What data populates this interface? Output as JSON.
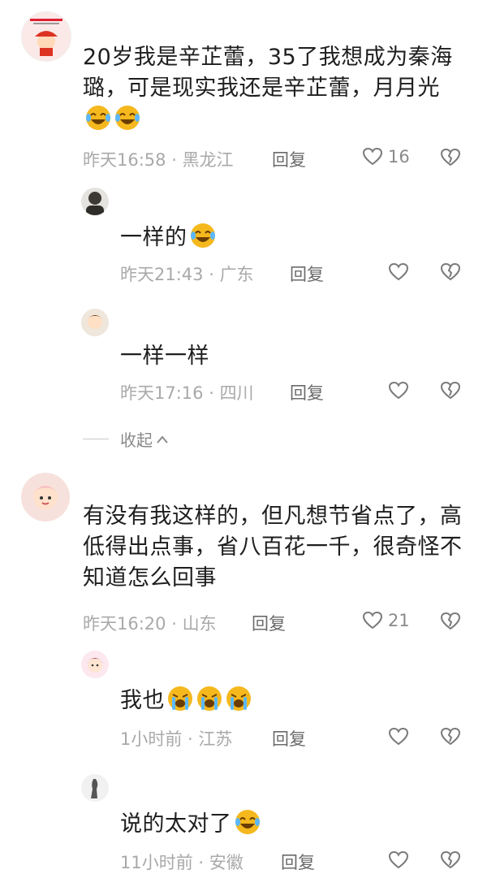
{
  "comments": [
    {
      "text": "20岁我是辛芷蕾，35了我想成为秦海璐，可是现实我还是辛芷蕾，月月光",
      "emoji": [
        "laugh-cry",
        "laugh-cry"
      ],
      "time": "昨天16:58",
      "location": "黑龙江",
      "reply_label": "回复",
      "likes": "16",
      "replies": [
        {
          "text": "一样的",
          "emoji": [
            "laugh-cry"
          ],
          "time": "昨天21:43",
          "location": "广东",
          "reply_label": "回复"
        },
        {
          "text": "一样一样",
          "emoji": [],
          "time": "昨天17:16",
          "location": "四川",
          "reply_label": "回复"
        }
      ],
      "collapse_label": "收起"
    },
    {
      "text": "有没有我这样的，但凡想节省点了，高低得出点事，省八百花一千，很奇怪不知道怎么回事",
      "emoji": [],
      "time": "昨天16:20",
      "location": "山东",
      "reply_label": "回复",
      "likes": "21",
      "replies": [
        {
          "text": "我也",
          "emoji": [
            "loud-cry",
            "loud-cry",
            "loud-cry"
          ],
          "time": "1小时前",
          "location": "江苏",
          "reply_label": "回复"
        },
        {
          "text": "说的太对了",
          "emoji": [
            "laugh-cry"
          ],
          "time": "11小时前",
          "location": "安徽",
          "reply_label": "回复"
        }
      ]
    }
  ],
  "colors": {
    "meta": "#a9a9a9",
    "text": "#1e1e1e",
    "emoji": "#f5b81d"
  }
}
